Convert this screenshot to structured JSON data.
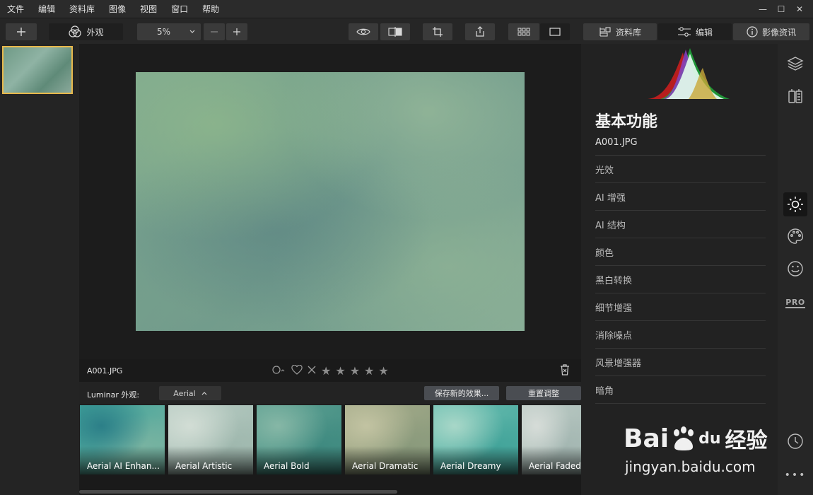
{
  "menu": [
    "文件",
    "编辑",
    "资料库",
    "图像",
    "视图",
    "窗口",
    "帮助"
  ],
  "window_controls": [
    "—",
    "☐",
    "✕"
  ],
  "toolbar": {
    "looks_label": "外观",
    "zoom": "5%",
    "library_label": "资料库",
    "edit_label": "编辑",
    "info_label": "影像资讯"
  },
  "viewer": {
    "filename": "A001.JPG"
  },
  "looks_bar": {
    "label": "Luminar 外观:",
    "selected": "Aerial",
    "save_label": "保存新的效果...",
    "reset_label": "重置调整"
  },
  "presets": [
    {
      "label": "Aerial AI Enhan...",
      "c1": "#3ea39a",
      "c2": "#78b3a1",
      "c3": "#2c7f88"
    },
    {
      "label": "Aerial Artistic",
      "c1": "#b9cdc4",
      "c2": "#9fb8ae",
      "c3": "#d2ddd5"
    },
    {
      "label": "Aerial Bold",
      "c1": "#5fa293",
      "c2": "#3f8a80",
      "c3": "#86b7a6"
    },
    {
      "label": "Aerial Dramatic",
      "c1": "#a8ae8c",
      "c2": "#8a9a7c",
      "c3": "#c2c3a2"
    },
    {
      "label": "Aerial Dreamy",
      "c1": "#6ec1b3",
      "c2": "#43a49a",
      "c3": "#a8d7c8"
    },
    {
      "label": "Aerial Faded",
      "c1": "#bccbc5",
      "c2": "#a4b7b2",
      "c3": "#d6dcd8"
    }
  ],
  "right_panel": {
    "title": "基本功能",
    "filename": "A001.JPG",
    "tools": [
      "光效",
      "AI 增强",
      "AI 结构",
      "颜色",
      "黑白转换",
      "细节增强",
      "消除噪点",
      "风景增强器",
      "暗角"
    ]
  },
  "icon_strip": {
    "pro_label": "PRO",
    "more": "•••"
  },
  "watermark": {
    "brand_bai": "Bai",
    "brand_du": "du",
    "brand_jingyan": "经验",
    "url": "jingyan.baidu.com"
  },
  "colors": {
    "accent_selected": "#e8b84b",
    "panel_bg": "#222222",
    "toolbar_bg": "#262626"
  }
}
